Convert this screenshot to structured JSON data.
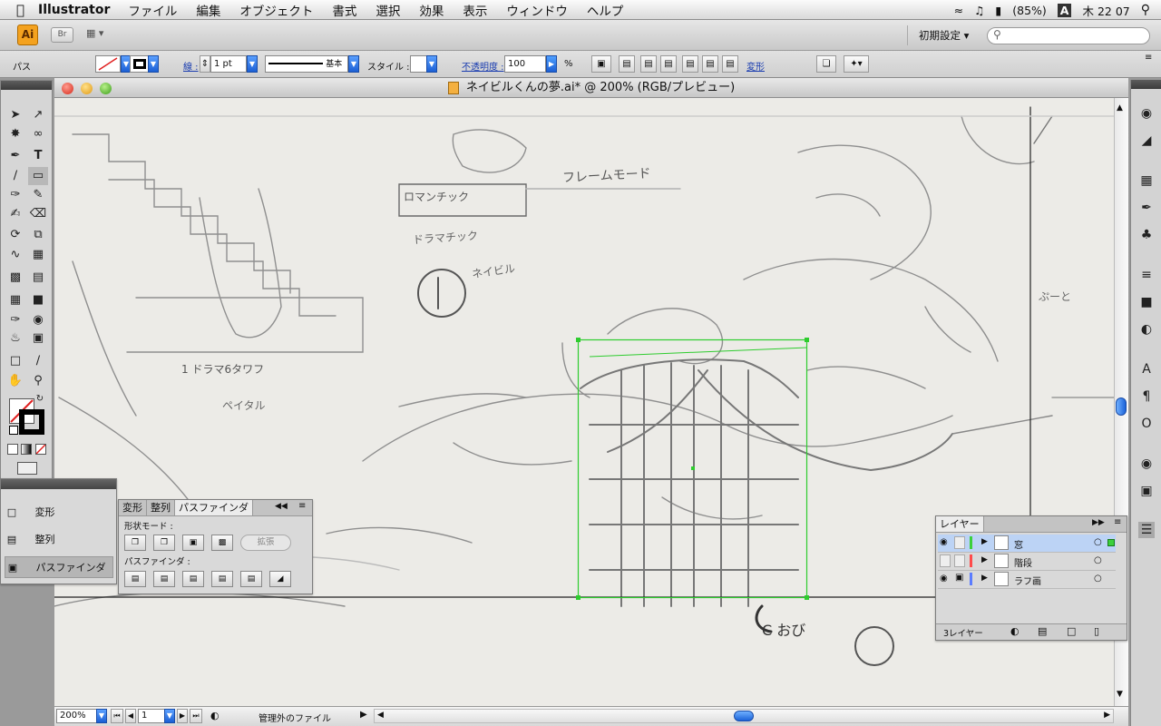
{
  "menubar": {
    "apple_icon": "apple-icon",
    "app_name": "Illustrator",
    "items": [
      "ファイル",
      "編集",
      "オブジェクト",
      "書式",
      "選択",
      "効果",
      "表示",
      "ウィンドウ",
      "ヘルプ"
    ],
    "battery": "(85%)",
    "input_mode": "A",
    "clock": "木 22 07"
  },
  "appbar": {
    "logo": "Ai",
    "bridge_label": "Br",
    "workspace_label": "初期設定 ▾"
  },
  "control": {
    "object_type": "パス",
    "stroke_label": "線 :",
    "stroke_weight": "1 pt",
    "brush_label": "基本",
    "style_label": "スタイル :",
    "opacity_label": "不透明度 :",
    "opacity_value": "100",
    "opacity_unit": "%",
    "transform_label": "変形"
  },
  "document": {
    "title": "ネイビルくんの夢.ai* @ 200% (RGB/プレビュー)"
  },
  "status": {
    "zoom": "200%",
    "page": "1",
    "info": "管理外のファイル"
  },
  "sketch": {
    "note_top": "フレームモード",
    "note_ctrl": "ロマンチック",
    "note_sub": "ドラマチック",
    "circle1": "①",
    "note_navy": "ネイビル",
    "note_left1": "1 ドラマ6タワフ",
    "note_left2": "ペイタル",
    "circle5": "⑤",
    "note_bottom": "C おび",
    "note_right": "ぷーと"
  },
  "mini_panel": {
    "items": [
      "変形",
      "整列",
      "パスファインダ"
    ]
  },
  "pathfinder": {
    "tabs": [
      "変形",
      "整列",
      "パスファインダ"
    ],
    "shape_modes_label": "形状モード :",
    "expand_label": "拡張",
    "pathfinders_label": "パスファインダ :"
  },
  "layers": {
    "title": "レイヤー",
    "rows": [
      {
        "name": "窓",
        "color": "#3cd03c"
      },
      {
        "name": "階段",
        "color": "#ff4b4b"
      },
      {
        "name": "ラフ画",
        "color": "#5b7cff"
      }
    ],
    "count": "3レイヤー"
  }
}
